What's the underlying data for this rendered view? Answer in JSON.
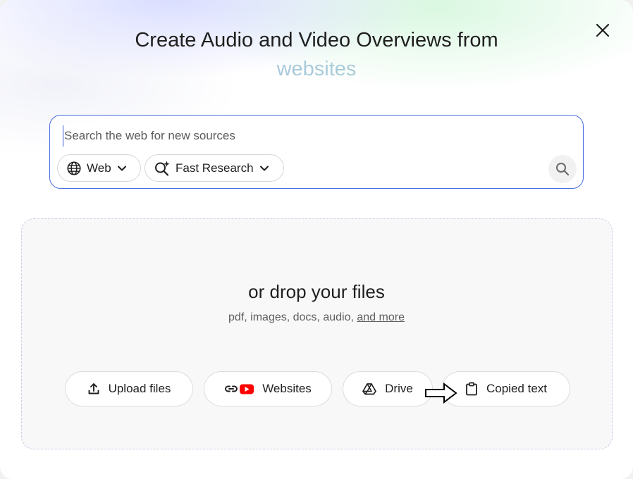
{
  "dialog": {
    "title": "Create Audio and Video Overviews from",
    "title_accent": "websites",
    "close_icon": "close-icon"
  },
  "search": {
    "placeholder": "Search the web for new sources",
    "value": "",
    "source_chip": {
      "label": "Web",
      "icon": "globe-icon"
    },
    "mode_chip": {
      "label": "Fast Research",
      "icon": "sparkle-search-icon"
    },
    "submit_icon": "search-icon"
  },
  "drop_zone": {
    "title": "or drop your files",
    "subtitle_prefix": "pdf, images, docs, audio,",
    "subtitle_link": "and more",
    "buttons": [
      {
        "label": "Upload files",
        "icon": "upload-icon"
      },
      {
        "label": "Websites",
        "icon": "link-youtube-icon"
      },
      {
        "label": "Drive",
        "icon": "drive-icon"
      },
      {
        "label": "Copied text",
        "icon": "clipboard-icon"
      }
    ]
  },
  "colors": {
    "accent_border": "#4a6ee0",
    "title_gradient_start": "#a8b8f0",
    "title_gradient_end": "#a9dcc4",
    "youtube_red": "#ff0000"
  }
}
